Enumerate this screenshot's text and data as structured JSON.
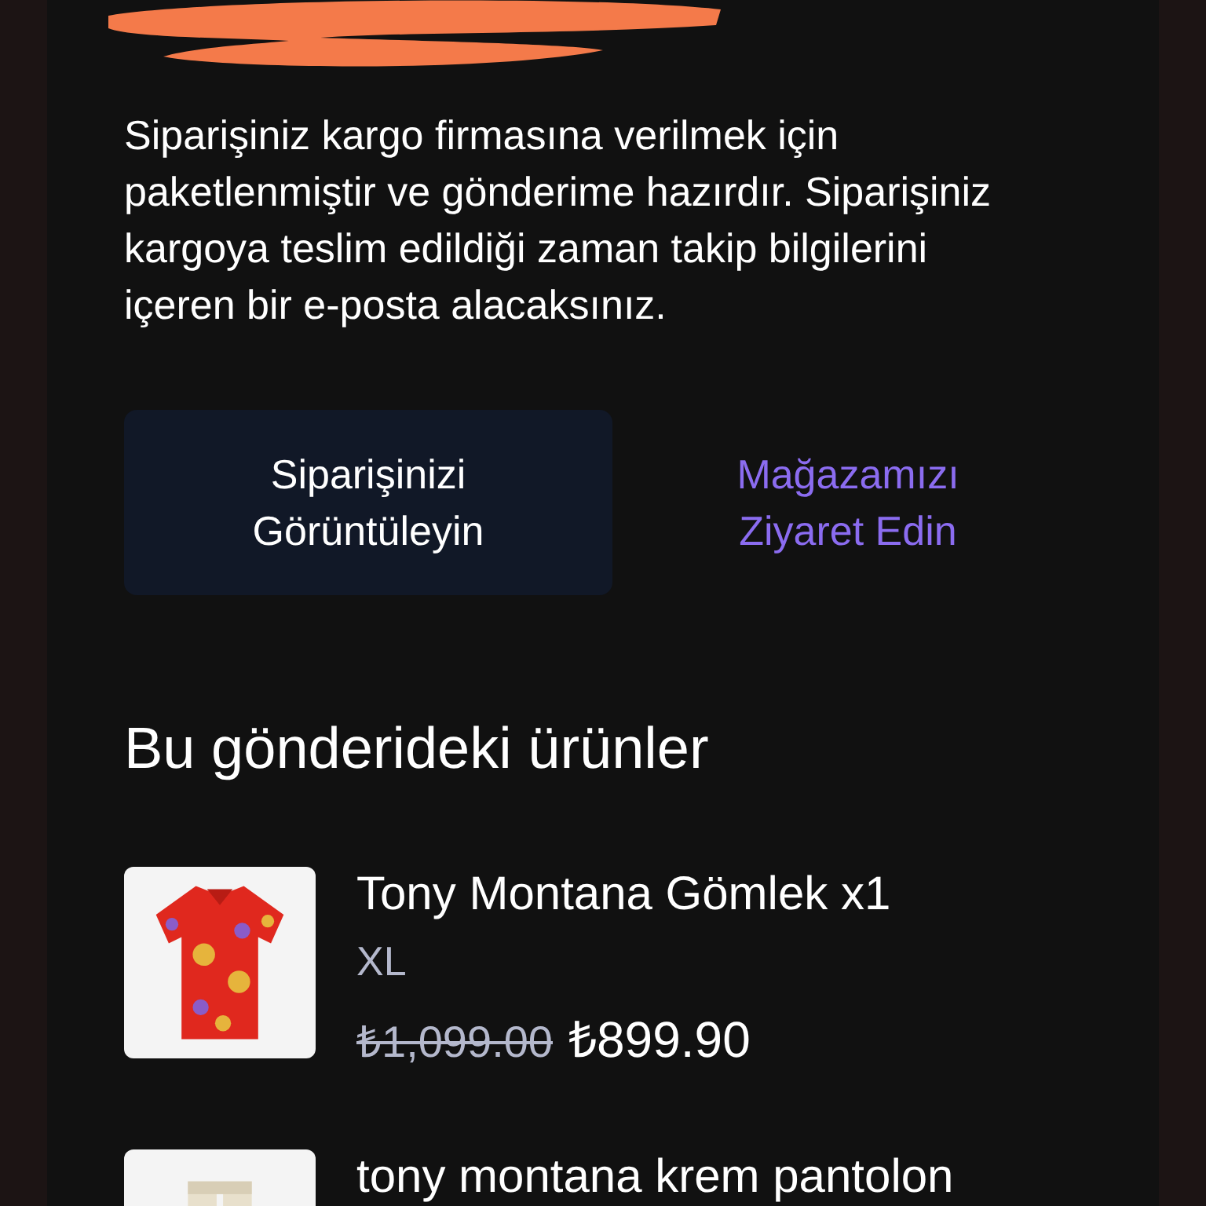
{
  "message": "Siparişiniz kargo firmasına verilmek için paketlenmiştir ve gönderime hazırdır. Siparişiniz kargoya teslim edildiği zaman takip bilgilerini içeren bir e-posta alacaksınız.",
  "actions": [
    {
      "label": "Siparişinizi Görüntüleyin",
      "kind": "primary"
    },
    {
      "label": "Mağazamızı Ziyaret Edin",
      "kind": "link"
    }
  ],
  "section_title": "Bu gönderideki ürünler",
  "products": [
    {
      "title": "Tony Montana Gömlek x1",
      "variant": "XL",
      "old_price": "₺1,099.00",
      "price": "₺899.90"
    },
    {
      "title": "tony montana krem pantolon"
    }
  ]
}
